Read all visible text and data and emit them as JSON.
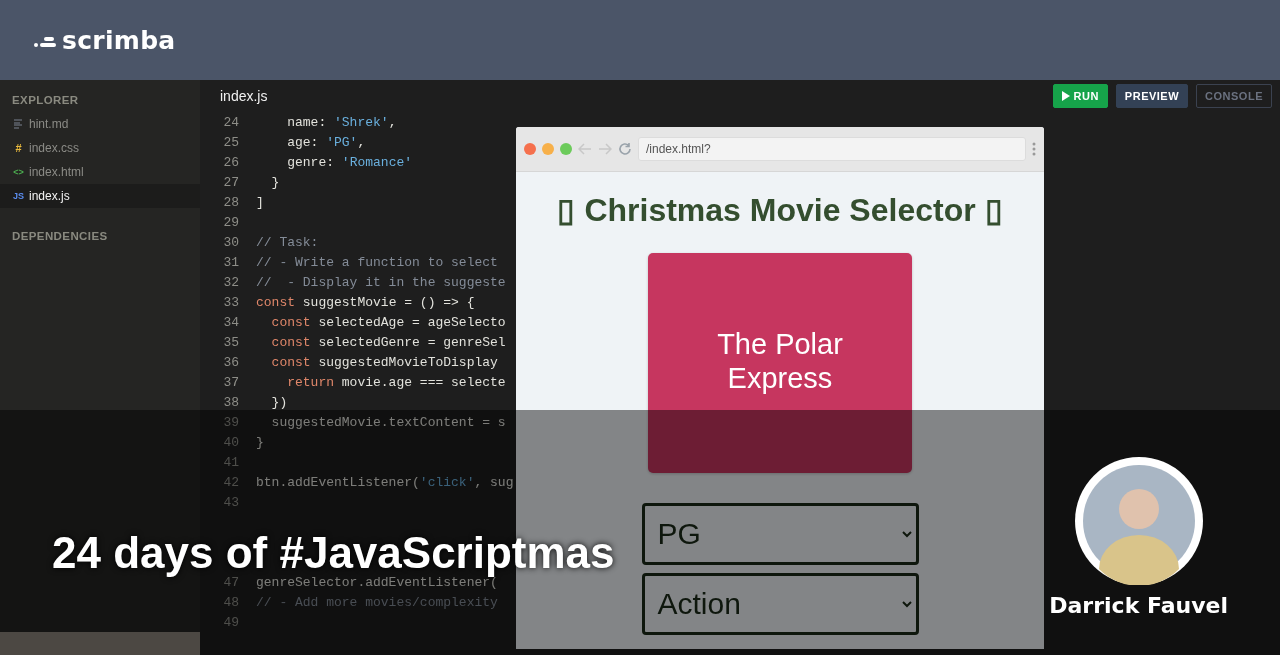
{
  "app": {
    "logo": "scrimba"
  },
  "sidebar": {
    "explorer_title": "EXPLORER",
    "files": [
      {
        "name": "hint.md",
        "kind": "md",
        "selected": false
      },
      {
        "name": "index.css",
        "kind": "css",
        "glyph": "#",
        "selected": false
      },
      {
        "name": "index.html",
        "kind": "html",
        "glyph": "<>",
        "selected": false
      },
      {
        "name": "index.js",
        "kind": "js",
        "glyph": "JS",
        "selected": true
      }
    ],
    "dependencies_title": "DEPENDENCIES"
  },
  "editor": {
    "tab": "index.js",
    "buttons": [
      {
        "label": "RUN",
        "kind": "run"
      },
      {
        "label": "PREVIEW",
        "kind": "toggle",
        "selected": true
      },
      {
        "label": "CONSOLE",
        "kind": "toggle",
        "selected": false
      }
    ],
    "lines": [
      {
        "number": "24",
        "tokens": [
          {
            "kind": "plain",
            "text": "    name: "
          },
          {
            "kind": "string",
            "text": "'Shrek'"
          },
          {
            "kind": "plain",
            "text": ","
          }
        ]
      },
      {
        "number": "25",
        "tokens": [
          {
            "kind": "plain",
            "text": "    age: "
          },
          {
            "kind": "string",
            "text": "'PG'"
          },
          {
            "kind": "plain",
            "text": ","
          }
        ]
      },
      {
        "number": "26",
        "tokens": [
          {
            "kind": "plain",
            "text": "    genre: "
          },
          {
            "kind": "string",
            "text": "'Romance'"
          }
        ]
      },
      {
        "number": "27",
        "tokens": [
          {
            "kind": "plain",
            "text": "  }"
          }
        ]
      },
      {
        "number": "28",
        "tokens": [
          {
            "kind": "plain",
            "text": "]"
          }
        ]
      },
      {
        "number": "29"
      },
      {
        "number": "30",
        "tokens": [
          {
            "kind": "comment",
            "text": "// Task:"
          }
        ]
      },
      {
        "number": "31",
        "tokens": [
          {
            "kind": "comment",
            "text": "// - Write a function to select"
          }
        ]
      },
      {
        "number": "32",
        "tokens": [
          {
            "kind": "comment",
            "text": "//  - Display it in the suggeste"
          }
        ]
      },
      {
        "number": "33",
        "tokens": [
          {
            "kind": "keyword",
            "text": "const"
          },
          {
            "kind": "plain",
            "text": " suggestMovie = () => {"
          }
        ]
      },
      {
        "number": "34",
        "tokens": [
          {
            "kind": "keyword",
            "text": "  const"
          },
          {
            "kind": "plain",
            "text": " selectedAge = ageSelecto"
          }
        ]
      },
      {
        "number": "35",
        "tokens": [
          {
            "kind": "keyword",
            "text": "  const"
          },
          {
            "kind": "plain",
            "text": " selectedGenre = genreSel"
          }
        ]
      },
      {
        "number": "36",
        "tokens": [
          {
            "kind": "keyword",
            "text": "  const"
          },
          {
            "kind": "plain",
            "text": " suggestedMovieToDisplay"
          }
        ]
      },
      {
        "number": "37",
        "tokens": [
          {
            "kind": "keyword",
            "text": "    return"
          },
          {
            "kind": "plain",
            "text": " movie.age === selecte"
          }
        ]
      },
      {
        "number": "38",
        "tokens": [
          {
            "kind": "plain",
            "text": "  })"
          }
        ]
      },
      {
        "number": "39",
        "tokens": [
          {
            "kind": "plain",
            "text": "  suggestedMovie.textContent = s"
          }
        ]
      },
      {
        "number": "40",
        "tokens": [
          {
            "kind": "plain",
            "text": "}"
          }
        ]
      },
      {
        "number": "41"
      },
      {
        "number": "42",
        "tokens": [
          {
            "kind": "plain",
            "text": "btn.addEventListener("
          },
          {
            "kind": "string",
            "text": "'click'"
          },
          {
            "kind": "plain",
            "text": ", sug"
          }
        ]
      },
      {
        "number": "43"
      }
    ],
    "lines_below_title": [
      {
        "number": "47",
        "tokens": [
          {
            "kind": "plain",
            "text": "genreSelector.addEventListener("
          }
        ]
      },
      {
        "number": "48",
        "tokens": [
          {
            "kind": "comment",
            "text": "// - Add more movies/complexity"
          }
        ]
      },
      {
        "number": "49"
      }
    ]
  },
  "preview": {
    "url": "/index.html?",
    "heading": "▯ Christmas Movie Selector ▯",
    "suggestion": "The Polar Express",
    "selects": [
      "PG",
      "Action"
    ]
  },
  "banner": {
    "title": "24 days of #JavaScriptmas",
    "author": "Darrick Fauvel"
  }
}
